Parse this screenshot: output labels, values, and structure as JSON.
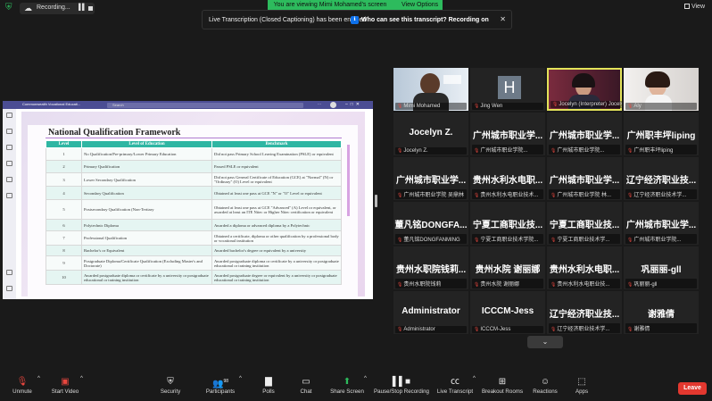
{
  "top": {
    "recording": "Recording...",
    "viewing": "You are viewing Mimi Mohamed's screen",
    "view_options": "View Options",
    "view": "View"
  },
  "toast": {
    "text": "Live Transcription (Closed Captioning) has been enabled",
    "link": "Who can see this transcript? Recording on"
  },
  "teams": {
    "window_title": "Commonwealth Vocational Educati...",
    "search_placeholder": "Search"
  },
  "slide": {
    "title": "National Qualification Framework",
    "headers": [
      "Level",
      "Level of Education",
      "Benchmark"
    ],
    "rows": [
      [
        "1",
        "No Qualification/Pre-primary/Lower Primary Education",
        "Did not pass Primary School Leaving Examination (PSLE) or equivalent"
      ],
      [
        "2",
        "Primary Qualification",
        "Passed PSLE or equivalent"
      ],
      [
        "3",
        "Lower Secondary Qualification",
        "Did not pass General Certificate of Education (GCE) at \"Normal\" (N) or \"Ordinary\" (O) Level or equivalent"
      ],
      [
        "4",
        "Secondary Qualification",
        "Obtained at least one pass at GCE \"N\" or \"O\" Level or equivalent"
      ],
      [
        "5",
        "Postsecondary Qualification (Non-Tertiary",
        "Obtained at least one pass at GCE \"Advanced\" (A) Level or equivalent, or awarded at least an ITE Nitec or Higher Nitec certification or equivalent"
      ],
      [
        "6",
        "Polytechnic Diploma",
        "Awarded a diploma or advanced diploma by a Polytechnic"
      ],
      [
        "7",
        "Professional Qualification",
        "Obtained a certificate, diploma or other qualification by a professional body or vocational institution"
      ],
      [
        "8",
        "Bachelor's or Equivalent",
        "Awarded bachelor's degree or equivalent by a university"
      ],
      [
        "9",
        "Postgraduate Diploma/Certificate Qualification (Excluding Master's and Doctorate)",
        "Awarded postgraduate diploma or certificate by a university or postgraduate educational or training institution"
      ],
      [
        "10",
        "Awarded postgraduate diploma or certificate by a university or postgraduate educational or training institution",
        "Awarded postgraduate degree or equivalent by a university or postgraduate educational or training institution"
      ]
    ]
  },
  "tiles": [
    {
      "big": "",
      "name": "Mimi Mohamed",
      "kind": "video-man"
    },
    {
      "big": "",
      "name": "Jing Wen",
      "kind": "h"
    },
    {
      "big": "",
      "name": "Jocelyn (Interpreter) Jocelyn",
      "kind": "video-woman",
      "active": true
    },
    {
      "big": "",
      "name": "Aly",
      "kind": "video-woman2"
    },
    {
      "big": "Jocelyn Z.",
      "name": "Jocelyn Z.",
      "kind": "name"
    },
    {
      "big": "广州城市职业学...",
      "name": "广州城市职业学院...",
      "kind": "name"
    },
    {
      "big": "广州城市职业学...",
      "name": "广州城市职业学院...",
      "kind": "name"
    },
    {
      "big": "广州职丰坪liping",
      "name": "广州职丰坪liping",
      "kind": "name"
    },
    {
      "big": "广州城市职业学...",
      "name": "广州城市职业学院 吴鼎林",
      "kind": "name"
    },
    {
      "big": "贵州水利水电职...",
      "name": "贵州水利水电职业技术...",
      "kind": "name"
    },
    {
      "big": "广州城市职业学...",
      "name": "广州城市职业学院 林...",
      "kind": "name"
    },
    {
      "big": "辽宁经济职业技...",
      "name": "辽宁经济职业技术学...",
      "kind": "name"
    },
    {
      "big": "董凡铭DONGFA...",
      "name": "董凡铭DONGFANMING",
      "kind": "name"
    },
    {
      "big": "宁夏工商职业技...",
      "name": "宁夏工商职业技术学院...",
      "kind": "name"
    },
    {
      "big": "宁夏工商职业技...",
      "name": "宁夏工商职业技术学...",
      "kind": "name"
    },
    {
      "big": "广州城市职业学...",
      "name": "广州城市职业学院...",
      "kind": "name"
    },
    {
      "big": "贵州水职院钱莉...",
      "name": "贵州水职院钱莉",
      "kind": "name"
    },
    {
      "big": "贵州水院 谢丽娜",
      "name": "贵州水院 谢丽娜",
      "kind": "name"
    },
    {
      "big": "贵州水利水电职...",
      "name": "贵州水利水电职业技...",
      "kind": "name"
    },
    {
      "big": "巩丽丽-gll",
      "name": "巩丽丽-gll",
      "kind": "name"
    },
    {
      "big": "Administrator",
      "name": "Administrator",
      "kind": "name"
    },
    {
      "big": "ICCCM-Jess",
      "name": "ICCCM-Jess",
      "kind": "name"
    },
    {
      "big": "辽宁经济职业技...",
      "name": "辽宁经济职业技术学...",
      "kind": "name"
    },
    {
      "big": "谢雅倩",
      "name": "谢雅倩",
      "kind": "name"
    }
  ],
  "toolbar": {
    "unmute": "Unmute",
    "start_video": "Start Video",
    "security": "Security",
    "participants": "Participants",
    "participants_count": "98",
    "polls": "Polls",
    "chat": "Chat",
    "share_screen": "Share Screen",
    "pause_recording": "Pause/Stop Recording",
    "live_transcript": "Live Transcript",
    "breakout_rooms": "Breakout Rooms",
    "reactions": "Reactions",
    "apps": "Apps",
    "leave": "Leave"
  },
  "colors": {
    "zoom_green": "#2dbb5d",
    "leave_red": "#e3382f",
    "teams_purple": "#4b4d93",
    "table_header_teal": "#2fb6a3",
    "active_speaker": "#e3e35a"
  }
}
